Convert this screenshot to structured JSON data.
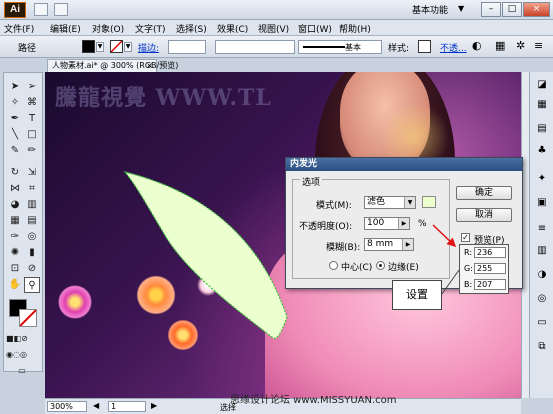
{
  "app": {
    "logo": "Ai",
    "workspace": "基本功能"
  },
  "menu": [
    "文件(F)",
    "编辑(E)",
    "对象(O)",
    "文字(T)",
    "选择(S)",
    "效果(C)",
    "视图(V)",
    "窗口(W)",
    "帮助(H)"
  ],
  "control": {
    "selection_label": "路径",
    "stroke_link": "描边:",
    "brush_label": "基本",
    "style_label": "样式:",
    "opacity_link": "不透..."
  },
  "document": {
    "tab_title": "人物素材.ai* @ 300% (RGB/预览)",
    "tab_close": "×"
  },
  "canvas": {
    "watermark": "騰龍視覺 WWW.TL"
  },
  "dialog": {
    "title": "内发光",
    "group_label": "选项",
    "mode_label": "模式(M):",
    "mode_value": "滤色",
    "opacity_label": "不透明度(O):",
    "opacity_value": "100",
    "opacity_unit": "%",
    "blur_label": "模糊(B):",
    "blur_value": "8 mm",
    "center_label": "中心(C)",
    "edge_label": "边缘(E)",
    "selected_source": "edge",
    "ok_label": "确定",
    "cancel_label": "取消",
    "preview_label": "预览(P)",
    "preview_checked": true,
    "glow_color": "#ecffcf"
  },
  "rgb_callout": {
    "r_label": "R:",
    "r_value": "236",
    "g_label": "G:",
    "g_value": "255",
    "b_label": "B:",
    "b_value": "207"
  },
  "callout": {
    "setting_label": "设置"
  },
  "status": {
    "zoom": "300%",
    "page": "1",
    "text": "选择",
    "site_credit": "思缘设计论坛 www.MISSYUAN.com"
  }
}
